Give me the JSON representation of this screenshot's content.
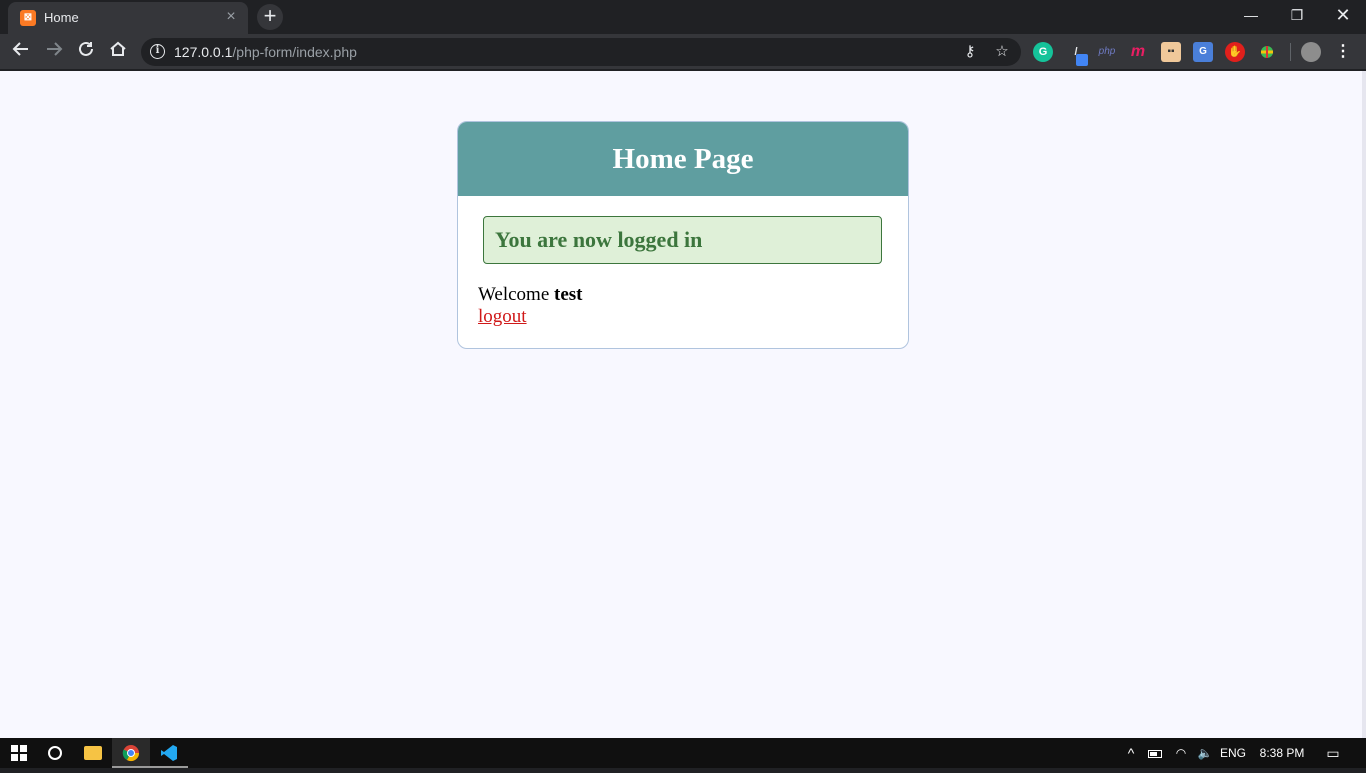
{
  "browser": {
    "tab": {
      "title": "Home"
    },
    "url": {
      "host": "127.0.0.1",
      "path": "/php-form/index.php"
    },
    "extensions": [
      "grammarly-icon",
      "pen-icon",
      "php-icon",
      "m-icon",
      "face-icon",
      "translate-icon",
      "adblock-icon",
      "globe-icon",
      "profile-avatar"
    ]
  },
  "page": {
    "header_title": "Home Page",
    "success_message": "You are now logged in",
    "welcome_prefix": "Welcome",
    "username": "test",
    "logout_label": "logout"
  },
  "taskbar": {
    "language": "ENG",
    "time": "8:38 PM"
  },
  "colors": {
    "header_bg": "#5f9ea0",
    "success_bg": "#dff0d8",
    "success_text": "#3c763d",
    "logout_link": "#d01818",
    "page_bg": "#f8f8ff"
  }
}
